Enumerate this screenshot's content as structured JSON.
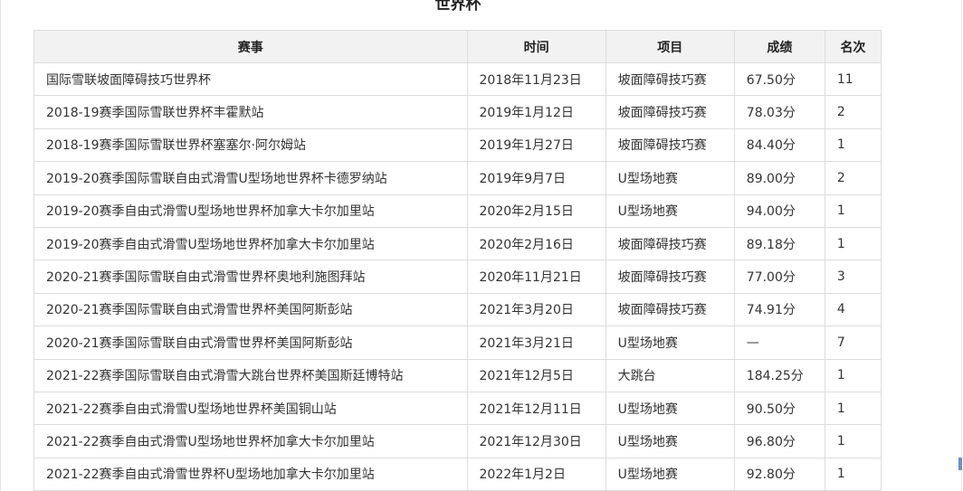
{
  "title": "世界杯",
  "table": {
    "headers": [
      "赛事",
      "时间",
      "项目",
      "成绩",
      "名次"
    ],
    "rows": [
      [
        "国际雪联坡面障碍技巧世界杯",
        "2018年11月23日",
        "坡面障碍技巧赛",
        "67.50分",
        "11"
      ],
      [
        "2018-19赛季国际雪联世界杯丰霍默站",
        "2019年1月12日",
        "坡面障碍技巧赛",
        "78.03分",
        "2"
      ],
      [
        "2018-19赛季国际雪联世界杯塞塞尔·阿尔姆站",
        "2019年1月27日",
        "坡面障碍技巧赛",
        "84.40分",
        "1"
      ],
      [
        "2019-20赛季国际雪联自由式滑雪U型场地世界杯卡德罗纳站",
        "2019年9月7日",
        "U型场地赛",
        "89.00分",
        "2"
      ],
      [
        "2019-20赛季自由式滑雪U型场地世界杯加拿大卡尔加里站",
        "2020年2月15日",
        "U型场地赛",
        "94.00分",
        "1"
      ],
      [
        "2019-20赛季自由式滑雪U型场地世界杯加拿大卡尔加里站",
        "2020年2月16日",
        "坡面障碍技巧赛",
        "89.18分",
        "1"
      ],
      [
        "2020-21赛季国际雪联自由式滑雪世界杯奥地利施图拜站",
        "2020年11月21日",
        "坡面障碍技巧赛",
        "77.00分",
        "3"
      ],
      [
        "2020-21赛季国际雪联自由式滑雪世界杯美国阿斯彭站",
        "2021年3月20日",
        "坡面障碍技巧赛",
        "74.91分",
        "4"
      ],
      [
        "2020-21赛季国际雪联自由式滑雪世界杯美国阿斯彭站",
        "2021年3月21日",
        "U型场地赛",
        "—",
        "7"
      ],
      [
        "2021-22赛季国际雪联自由式滑雪大跳台世界杯美国斯廷博特站",
        "2021年12月5日",
        "大跳台",
        "184.25分",
        "1"
      ],
      [
        "2021-22赛季自由式滑雪U型场地世界杯美国铜山站",
        "2021年12月11日",
        "U型场地赛",
        "90.50分",
        "1"
      ],
      [
        "2021-22赛季自由式滑雪U型场地世界杯加拿大卡尔加里站",
        "2021年12月30日",
        "U型场地赛",
        "96.80分",
        "1"
      ],
      [
        "2021-22赛季自由式滑雪世界杯U型场地加拿大卡尔加里站",
        "2022年1月2日",
        "U型场地赛",
        "92.80分",
        "1"
      ]
    ]
  }
}
